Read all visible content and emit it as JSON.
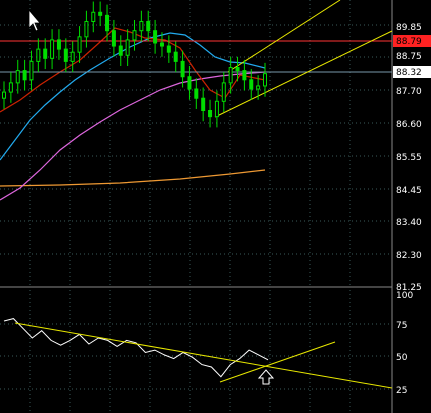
{
  "colors": {
    "background": "#000000",
    "grid": "#3a5a5a",
    "candle": "#00dd00",
    "price_line": "#ff3333",
    "ma_short": "#cc2200",
    "ma_mid": "#22aaee",
    "ma_long": "#dd66dd",
    "ma_200": "#ee9933",
    "channel": "#e8e800",
    "oscillator": "#ffffff",
    "arrow": "#ffffff"
  },
  "price_axis": {
    "labels": [
      "89.85",
      "88.75",
      "88.32",
      "87.70",
      "86.60",
      "85.55",
      "84.45",
      "83.40",
      "82.30",
      "81.25"
    ],
    "highlight_red": "88.79",
    "highlight_gray": "88.32"
  },
  "indicator_axis": {
    "labels": [
      "100",
      "75",
      "50",
      "25"
    ]
  },
  "chart_data": {
    "type": "line",
    "panels": [
      {
        "name": "price",
        "ylim": [
          81.25,
          90.6
        ],
        "series": [
          {
            "values": [
              87.6,
              87.9,
              88.3,
              88.0,
              88.6,
              89.0,
              88.7,
              89.3,
              89.0,
              88.6,
              88.9,
              89.4,
              89.9,
              90.2,
              90.1,
              89.6,
              89.1,
              88.8,
              89.3,
              89.6,
              89.9,
              89.6,
              89.2,
              89.1,
              88.9,
              88.6,
              88.1,
              87.7,
              87.4,
              87.0,
              86.8,
              87.3,
              87.9,
              88.4,
              88.3,
              88.0,
              87.7,
              87.8,
              88.2
            ]
          }
        ]
      },
      {
        "name": "oscillator",
        "ylim": [
          0,
          100
        ],
        "series": [
          {
            "values": [
              76,
              78,
              70,
              62,
              68,
              60,
              56,
              60,
              65,
              57,
              62,
              60,
              55,
              60,
              58,
              50,
              52,
              48,
              45,
              50,
              46,
              40,
              38,
              30,
              40,
              45,
              52,
              48,
              44
            ]
          }
        ]
      }
    ]
  }
}
